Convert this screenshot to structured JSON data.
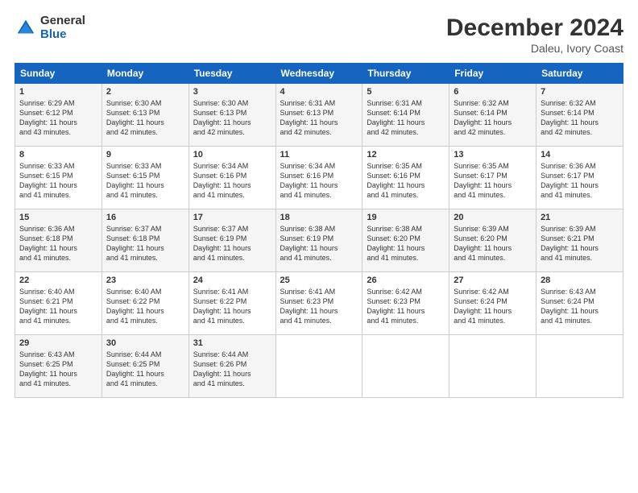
{
  "logo": {
    "general": "General",
    "blue": "Blue"
  },
  "header": {
    "month": "December 2024",
    "location": "Daleu, Ivory Coast"
  },
  "days_of_week": [
    "Sunday",
    "Monday",
    "Tuesday",
    "Wednesday",
    "Thursday",
    "Friday",
    "Saturday"
  ],
  "weeks": [
    [
      {
        "day": "1",
        "info": "Sunrise: 6:29 AM\nSunset: 6:12 PM\nDaylight: 11 hours\nand 43 minutes."
      },
      {
        "day": "2",
        "info": "Sunrise: 6:30 AM\nSunset: 6:13 PM\nDaylight: 11 hours\nand 42 minutes."
      },
      {
        "day": "3",
        "info": "Sunrise: 6:30 AM\nSunset: 6:13 PM\nDaylight: 11 hours\nand 42 minutes."
      },
      {
        "day": "4",
        "info": "Sunrise: 6:31 AM\nSunset: 6:13 PM\nDaylight: 11 hours\nand 42 minutes."
      },
      {
        "day": "5",
        "info": "Sunrise: 6:31 AM\nSunset: 6:14 PM\nDaylight: 11 hours\nand 42 minutes."
      },
      {
        "day": "6",
        "info": "Sunrise: 6:32 AM\nSunset: 6:14 PM\nDaylight: 11 hours\nand 42 minutes."
      },
      {
        "day": "7",
        "info": "Sunrise: 6:32 AM\nSunset: 6:14 PM\nDaylight: 11 hours\nand 42 minutes."
      }
    ],
    [
      {
        "day": "8",
        "info": "Sunrise: 6:33 AM\nSunset: 6:15 PM\nDaylight: 11 hours\nand 41 minutes."
      },
      {
        "day": "9",
        "info": "Sunrise: 6:33 AM\nSunset: 6:15 PM\nDaylight: 11 hours\nand 41 minutes."
      },
      {
        "day": "10",
        "info": "Sunrise: 6:34 AM\nSunset: 6:16 PM\nDaylight: 11 hours\nand 41 minutes."
      },
      {
        "day": "11",
        "info": "Sunrise: 6:34 AM\nSunset: 6:16 PM\nDaylight: 11 hours\nand 41 minutes."
      },
      {
        "day": "12",
        "info": "Sunrise: 6:35 AM\nSunset: 6:16 PM\nDaylight: 11 hours\nand 41 minutes."
      },
      {
        "day": "13",
        "info": "Sunrise: 6:35 AM\nSunset: 6:17 PM\nDaylight: 11 hours\nand 41 minutes."
      },
      {
        "day": "14",
        "info": "Sunrise: 6:36 AM\nSunset: 6:17 PM\nDaylight: 11 hours\nand 41 minutes."
      }
    ],
    [
      {
        "day": "15",
        "info": "Sunrise: 6:36 AM\nSunset: 6:18 PM\nDaylight: 11 hours\nand 41 minutes."
      },
      {
        "day": "16",
        "info": "Sunrise: 6:37 AM\nSunset: 6:18 PM\nDaylight: 11 hours\nand 41 minutes."
      },
      {
        "day": "17",
        "info": "Sunrise: 6:37 AM\nSunset: 6:19 PM\nDaylight: 11 hours\nand 41 minutes."
      },
      {
        "day": "18",
        "info": "Sunrise: 6:38 AM\nSunset: 6:19 PM\nDaylight: 11 hours\nand 41 minutes."
      },
      {
        "day": "19",
        "info": "Sunrise: 6:38 AM\nSunset: 6:20 PM\nDaylight: 11 hours\nand 41 minutes."
      },
      {
        "day": "20",
        "info": "Sunrise: 6:39 AM\nSunset: 6:20 PM\nDaylight: 11 hours\nand 41 minutes."
      },
      {
        "day": "21",
        "info": "Sunrise: 6:39 AM\nSunset: 6:21 PM\nDaylight: 11 hours\nand 41 minutes."
      }
    ],
    [
      {
        "day": "22",
        "info": "Sunrise: 6:40 AM\nSunset: 6:21 PM\nDaylight: 11 hours\nand 41 minutes."
      },
      {
        "day": "23",
        "info": "Sunrise: 6:40 AM\nSunset: 6:22 PM\nDaylight: 11 hours\nand 41 minutes."
      },
      {
        "day": "24",
        "info": "Sunrise: 6:41 AM\nSunset: 6:22 PM\nDaylight: 11 hours\nand 41 minutes."
      },
      {
        "day": "25",
        "info": "Sunrise: 6:41 AM\nSunset: 6:23 PM\nDaylight: 11 hours\nand 41 minutes."
      },
      {
        "day": "26",
        "info": "Sunrise: 6:42 AM\nSunset: 6:23 PM\nDaylight: 11 hours\nand 41 minutes."
      },
      {
        "day": "27",
        "info": "Sunrise: 6:42 AM\nSunset: 6:24 PM\nDaylight: 11 hours\nand 41 minutes."
      },
      {
        "day": "28",
        "info": "Sunrise: 6:43 AM\nSunset: 6:24 PM\nDaylight: 11 hours\nand 41 minutes."
      }
    ],
    [
      {
        "day": "29",
        "info": "Sunrise: 6:43 AM\nSunset: 6:25 PM\nDaylight: 11 hours\nand 41 minutes."
      },
      {
        "day": "30",
        "info": "Sunrise: 6:44 AM\nSunset: 6:25 PM\nDaylight: 11 hours\nand 41 minutes."
      },
      {
        "day": "31",
        "info": "Sunrise: 6:44 AM\nSunset: 6:26 PM\nDaylight: 11 hours\nand 41 minutes."
      },
      {
        "day": "",
        "info": ""
      },
      {
        "day": "",
        "info": ""
      },
      {
        "day": "",
        "info": ""
      },
      {
        "day": "",
        "info": ""
      }
    ]
  ]
}
